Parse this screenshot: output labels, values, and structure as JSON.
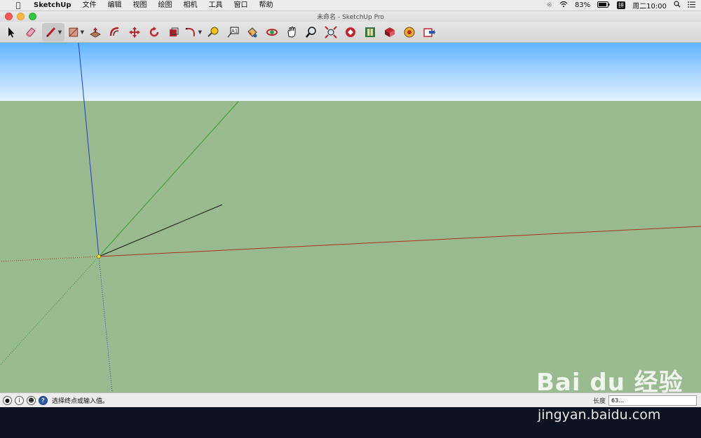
{
  "menubar": {
    "app_name": "SketchUp",
    "items": [
      "文件",
      "编辑",
      "视图",
      "绘图",
      "相机",
      "工具",
      "窗口",
      "帮助"
    ],
    "battery": "83%",
    "clock": "周二10:00"
  },
  "window": {
    "title": "未命名 - SketchUp Pro"
  },
  "toolbar": {
    "tools": [
      {
        "name": "select-tool-icon"
      },
      {
        "name": "eraser-tool-icon"
      },
      {
        "name": "line-tool-icon",
        "active": true
      },
      {
        "name": "rectangle-tool-icon"
      },
      {
        "name": "push-pull-tool-icon"
      },
      {
        "name": "offset-tool-icon"
      },
      {
        "name": "move-tool-icon"
      },
      {
        "name": "rotate-tool-icon"
      },
      {
        "name": "scale-tool-icon"
      },
      {
        "name": "arc-tool-icon"
      },
      {
        "name": "tape-measure-tool-icon"
      },
      {
        "name": "text-tool-icon"
      },
      {
        "name": "paint-bucket-tool-icon"
      },
      {
        "name": "orbit-tool-icon"
      },
      {
        "name": "pan-tool-icon"
      },
      {
        "name": "zoom-tool-icon"
      },
      {
        "name": "zoom-extents-tool-icon"
      },
      {
        "name": "3d-warehouse-icon"
      },
      {
        "name": "extension-warehouse-icon"
      },
      {
        "name": "layout-icon"
      },
      {
        "name": "extension-manager-icon"
      },
      {
        "name": "send-to-layout-icon"
      }
    ]
  },
  "status": {
    "hint": "选择终点或输入值。",
    "measure_label": "长度",
    "measure_value": "63..."
  },
  "watermark": {
    "logo": "Bai du 经验",
    "url": "jingyan.baidu.com"
  },
  "colors": {
    "sky_top": "#5fb5ff",
    "ground": "#9aba8f",
    "x_axis": "#c0392b",
    "y_axis": "#2ea12e",
    "z_axis": "#1f3fd0"
  }
}
